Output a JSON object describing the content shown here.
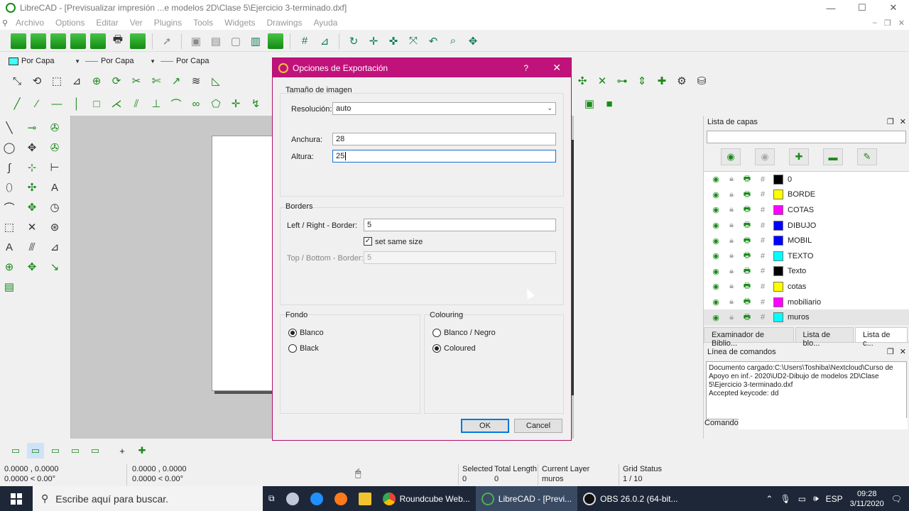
{
  "window": {
    "title": "LibreCAD - [Previsualizar impresión ...e modelos 2D\\Clase 5\\Ejercicio 3-terminado.dxf]",
    "controls": [
      "—",
      "☐",
      "✕"
    ]
  },
  "menu": [
    "Archivo",
    "Options",
    "Editar",
    "Ver",
    "Plugins",
    "Tools",
    "Widgets",
    "Drawings",
    "Ayuda"
  ],
  "pen_toolbar": {
    "color": "Por Capa",
    "width": "Por Capa",
    "type": "Por Capa"
  },
  "dialog": {
    "title": "Opciones de Exportación",
    "help": "?",
    "close": "✕",
    "image_size_group": "Tamaño de imagen",
    "resolution_label": "Resolución:",
    "resolution_value": "auto",
    "width_label": "Anchura:",
    "width_value": "28",
    "height_label": "Altura:",
    "height_value": "25",
    "borders_group": "Borders",
    "lr_border_label": "Left / Right - Border:",
    "lr_border_value": "5",
    "same_size_label": "set same size",
    "same_size_checked": true,
    "tb_border_label": "Top / Bottom - Border:",
    "tb_border_value": "5",
    "background_group": "Fondo",
    "bg_options": [
      "Blanco",
      "Black"
    ],
    "bg_selected": "Blanco",
    "colouring_group": "Colouring",
    "colour_options": [
      "Blanco / Negro",
      "Coloured"
    ],
    "colour_selected": "Coloured",
    "ok": "OK",
    "cancel": "Cancel"
  },
  "layer_panel": {
    "title": "Lista de capas",
    "layers": [
      {
        "name": "0",
        "color": "#000000"
      },
      {
        "name": "BORDE",
        "color": "#ffff00"
      },
      {
        "name": "COTAS",
        "color": "#ff00ff"
      },
      {
        "name": "DIBUJO",
        "color": "#0000ff"
      },
      {
        "name": "MOBIL",
        "color": "#0000ff"
      },
      {
        "name": "TEXTO",
        "color": "#00ffff"
      },
      {
        "name": "Texto",
        "color": "#000000"
      },
      {
        "name": "cotas",
        "color": "#ffff00"
      },
      {
        "name": "mobiliario",
        "color": "#ff00ff"
      },
      {
        "name": "muros",
        "color": "#00ffff"
      }
    ],
    "selected_layer": "muros",
    "tabs": [
      "Examinador de Biblio...",
      "Lista de blo...",
      "Lista de c..."
    ]
  },
  "command_panel": {
    "title": "Línea de comandos",
    "output": "Documento cargado:C:\\Users\\Toshiba\\Nextcloud\\Curso de Apoyo en inf.- 2020\\UD2-Dibujo de modelos 2D\\Clase 5\\Ejercicio 3-terminado.dxf\nAccepted keycode: dd",
    "command_label": "Comando:"
  },
  "status": {
    "abs_coord": "0.0000 , 0.0000",
    "abs_polar": "0.0000 < 0.00°",
    "rel_coord": "0.0000 , 0.0000",
    "rel_polar": "0.0000 < 0.00°",
    "selected_label": "Selected",
    "selected_value": "0",
    "total_length_label": "Total Length",
    "total_length_value": "0",
    "current_layer_label": "Current Layer",
    "current_layer_value": "muros",
    "grid_status_label": "Grid Status",
    "grid_status_value": "1 / 10"
  },
  "taskbar": {
    "search_placeholder": "Escribe aquí para buscar.",
    "apps": [
      "Roundcube Web...",
      "LibreCAD - [Previ...",
      "OBS 26.0.2 (64-bit..."
    ],
    "lang": "ESP",
    "time": "09:28",
    "date": "3/11/2020"
  }
}
